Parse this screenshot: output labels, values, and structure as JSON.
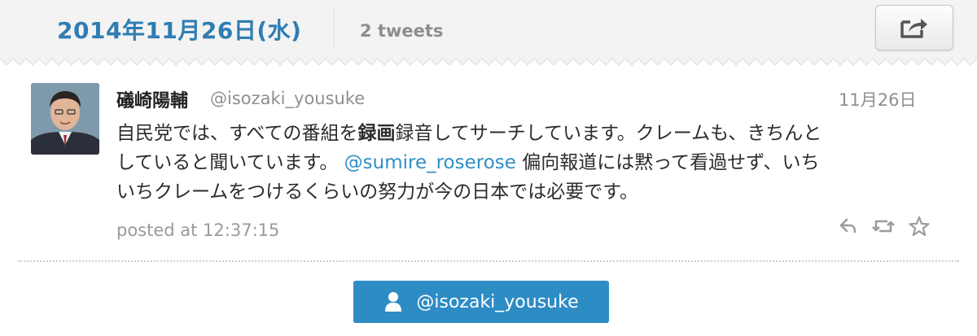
{
  "header": {
    "date": "2014年11月26日(水)",
    "tweet_count": "2 tweets",
    "share_icon": "share-icon"
  },
  "tweet": {
    "author_name": "礒崎陽輔",
    "author_handle": "@isozaki_yousuke",
    "date": "11月26日",
    "body": {
      "line1_prefix": "自民党では、すべての番組を",
      "line1_bold": "録画",
      "line1_suffix": "録音してサーチしています。クレームも、きちんと",
      "line2_prefix": "していると聞いています。 ",
      "line2_mention": "@sumire_roserose",
      "line2_suffix": " 偏向報道には黙って看過せず、いち",
      "line3": "いちクレームをつけるくらいの努力が今の日本では必要です。"
    },
    "posted_at": "posted at 12:37:15",
    "actions": [
      "reply-icon",
      "retweet-icon",
      "favorite-icon"
    ]
  },
  "follow_button": {
    "label": "@isozaki_yousuke",
    "icon": "user-icon"
  },
  "colors": {
    "accent": "#2f7db3",
    "mention": "#2f8fc6",
    "button": "#2e8cc5",
    "header_bg": "#f3f3f3"
  }
}
